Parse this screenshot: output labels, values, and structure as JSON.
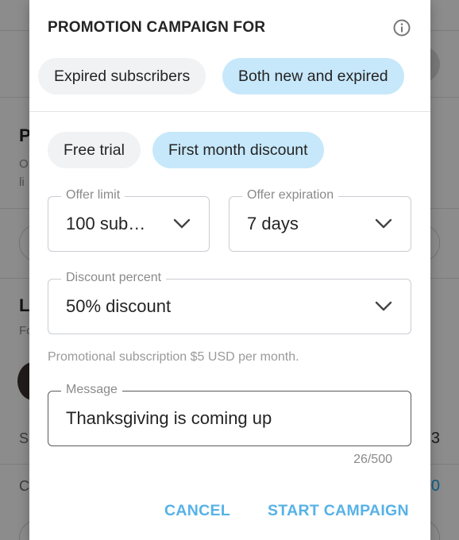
{
  "modal": {
    "title": "PROMOTION CAMPAIGN FOR",
    "info_icon": "info-icon",
    "audience_options": [
      {
        "label": "Expired subscribers",
        "selected": false
      },
      {
        "label": "Both new and expired",
        "selected": true
      }
    ],
    "offer_types": [
      {
        "label": "Free trial",
        "selected": false
      },
      {
        "label": "First month discount",
        "selected": true
      }
    ],
    "offer_limit": {
      "label": "Offer limit",
      "value": "100 sub…"
    },
    "offer_expiration": {
      "label": "Offer expiration",
      "value": "7 days"
    },
    "discount_percent": {
      "label": "Discount percent",
      "value": "50% discount"
    },
    "hint": "Promotional subscription $5 USD per month.",
    "message": {
      "label": "Message",
      "value": "Thanksgiving is coming up"
    },
    "counter": "26/500",
    "cancel_label": "CANCEL",
    "start_label": "START CAMPAIGN"
  },
  "background": {
    "letters": [
      "P",
      "L"
    ],
    "right_values": [
      "3",
      "0"
    ]
  },
  "colors": {
    "selected_chip": "#c7e8fb",
    "unselected_chip": "#f0f2f4",
    "action": "#57b2e6"
  }
}
